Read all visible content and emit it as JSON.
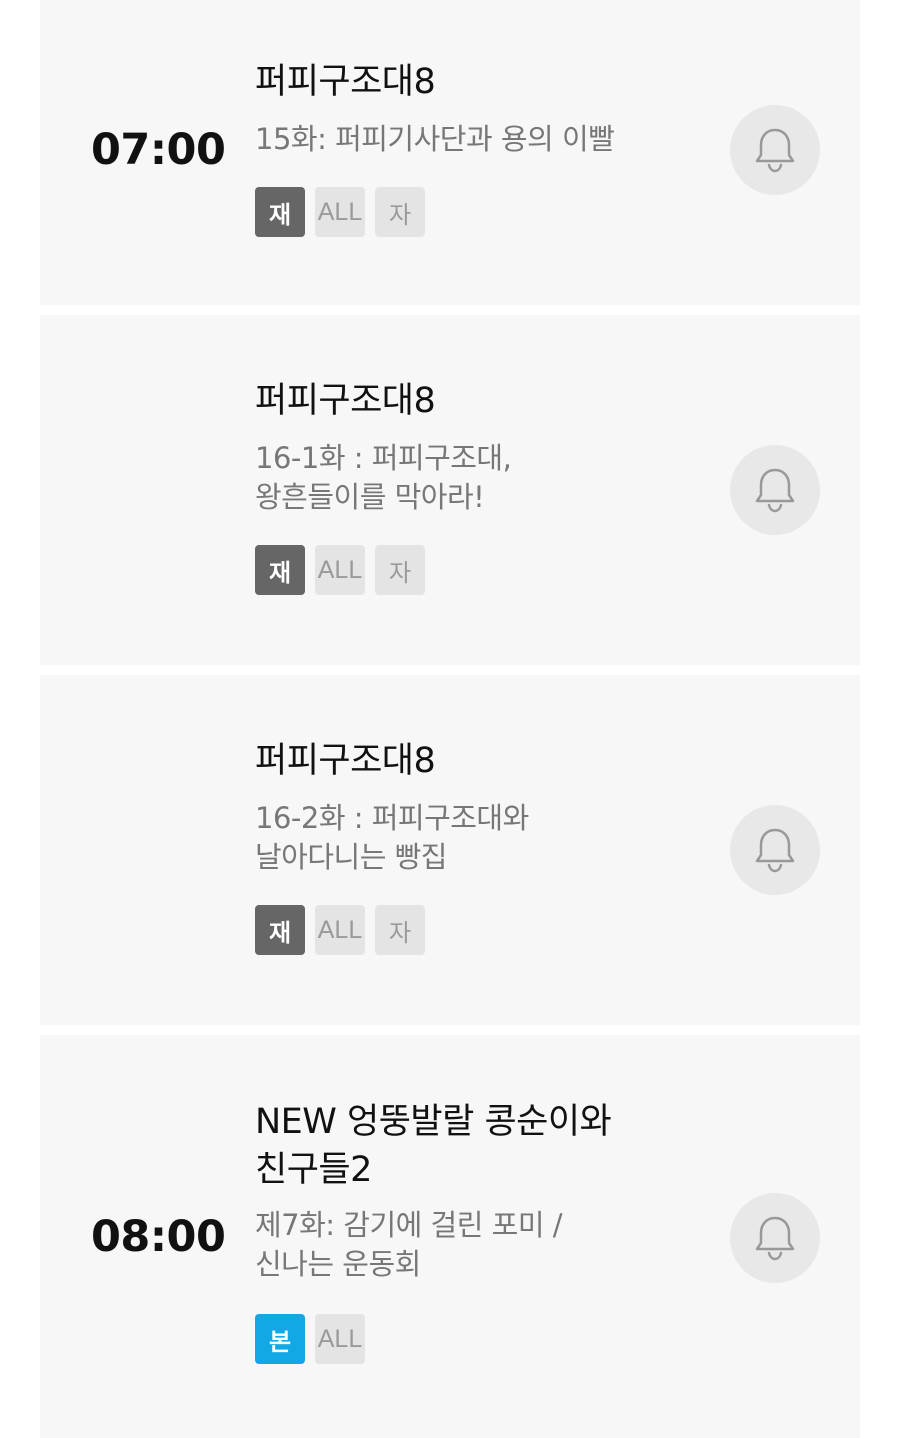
{
  "programs": [
    {
      "time": "07:00",
      "title": "퍼피구조대8",
      "episode_lines": [
        "15화: 퍼피기사단과 용의 이빨"
      ],
      "badges": [
        {
          "label": "재",
          "kind": "re"
        },
        {
          "label": "ALL",
          "kind": "all"
        },
        {
          "label": "자",
          "kind": "ja"
        }
      ],
      "bell_icon": "bell-icon"
    },
    {
      "time": "",
      "title": "퍼피구조대8",
      "episode_lines": [
        "16-1화 : 퍼피구조대,",
        "왕흔들이를 막아라!"
      ],
      "badges": [
        {
          "label": "재",
          "kind": "re"
        },
        {
          "label": "ALL",
          "kind": "all"
        },
        {
          "label": "자",
          "kind": "ja"
        }
      ],
      "bell_icon": "bell-icon"
    },
    {
      "time": "",
      "title": "퍼피구조대8",
      "episode_lines": [
        "16-2화 : 퍼피구조대와",
        "날아다니는 빵집"
      ],
      "badges": [
        {
          "label": "재",
          "kind": "re"
        },
        {
          "label": "ALL",
          "kind": "all"
        },
        {
          "label": "자",
          "kind": "ja"
        }
      ],
      "bell_icon": "bell-icon"
    },
    {
      "time": "08:00",
      "title_lines": [
        "NEW 엉뚱발랄 콩순이와",
        "친구들2"
      ],
      "episode_lines": [
        "제7화: 감기에 걸린 포미 /",
        "신나는 운동회"
      ],
      "badges": [
        {
          "label": "본",
          "kind": "bon"
        },
        {
          "label": "ALL",
          "kind": "all"
        }
      ],
      "bell_icon": "bell-icon"
    }
  ],
  "colors": {
    "card_bg": "#f7f7f7",
    "rerun_badge": "#666666",
    "premiere_badge": "#12a8e6",
    "rating_badge": "#e4e4e4"
  }
}
